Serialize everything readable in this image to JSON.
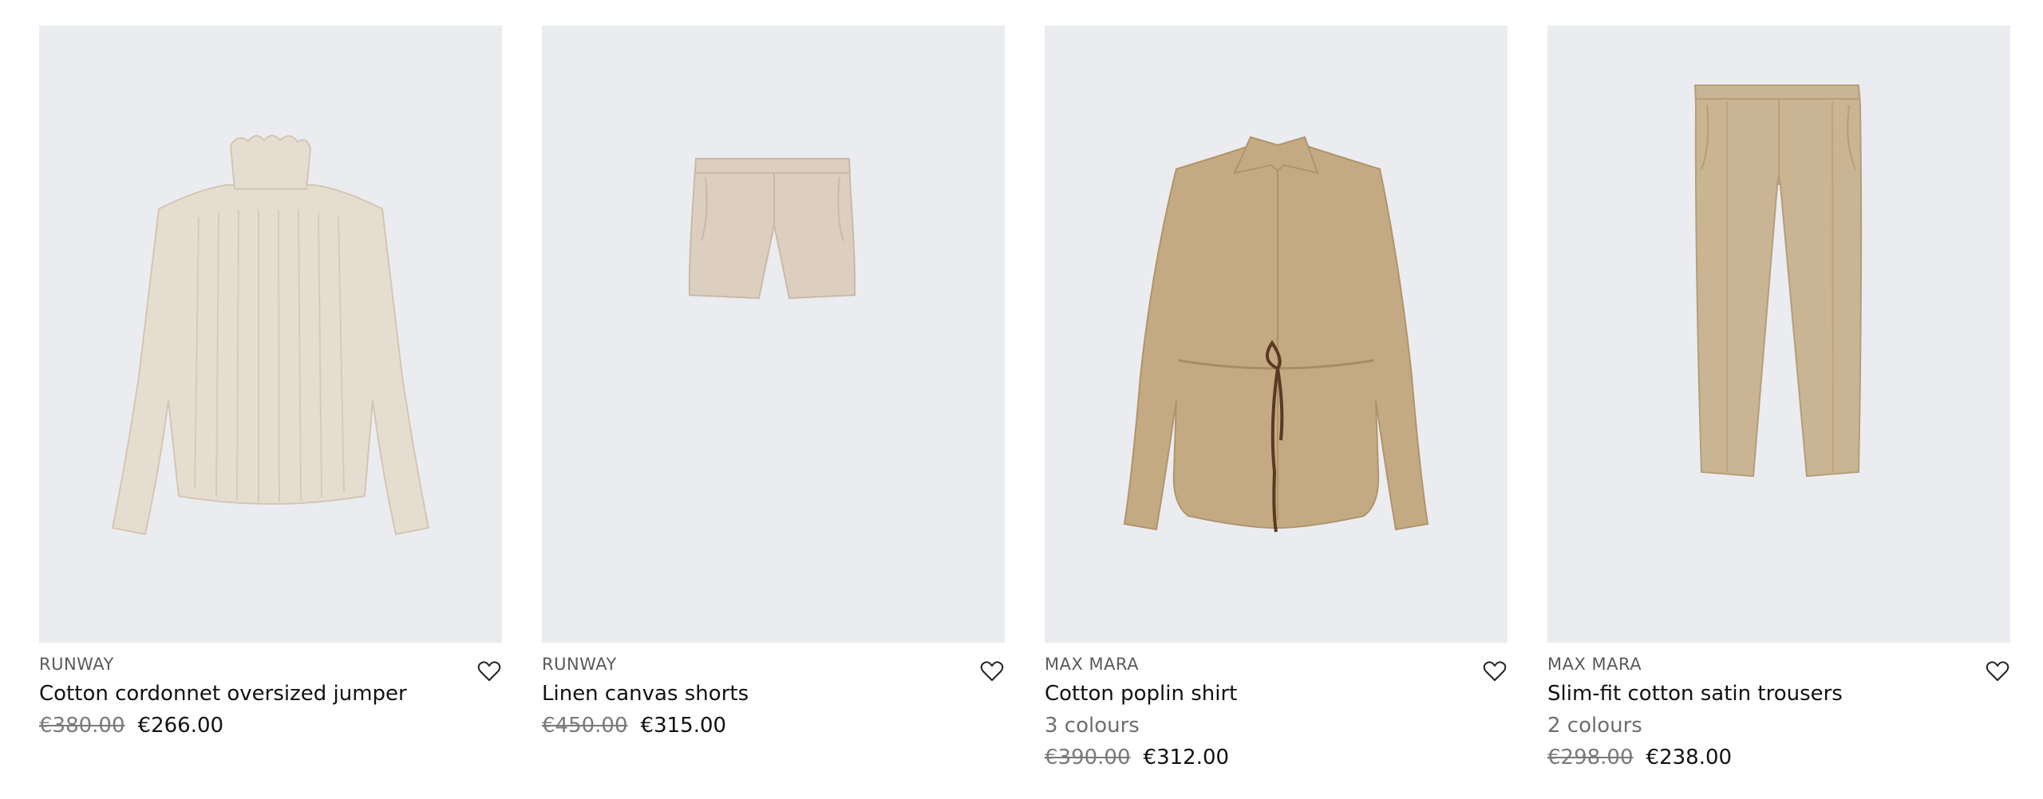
{
  "products": [
    {
      "brand": "RUNWAY",
      "name": "Cotton cordonnet oversized jumper",
      "colours": "",
      "price_old": "€380.00",
      "price_new": "€266.00",
      "image": "jumper",
      "image_color": "#e6ddd1"
    },
    {
      "brand": "RUNWAY",
      "name": "Linen canvas shorts",
      "colours": "",
      "price_old": "€450.00",
      "price_new": "€315.00",
      "image": "shorts",
      "image_color": "#dccfc0"
    },
    {
      "brand": "MAX MARA",
      "name": "Cotton poplin shirt",
      "colours": "3 colours",
      "price_old": "€390.00",
      "price_new": "€312.00",
      "image": "shirt",
      "image_color": "#c4aa82"
    },
    {
      "brand": "MAX MARA",
      "name": "Slim-fit cotton satin trousers",
      "colours": "2 colours",
      "price_old": "€298.00",
      "price_new": "€238.00",
      "image": "trousers",
      "image_color": "#c9b493"
    }
  ],
  "icons": {
    "wishlist": "heart-outline-icon"
  }
}
